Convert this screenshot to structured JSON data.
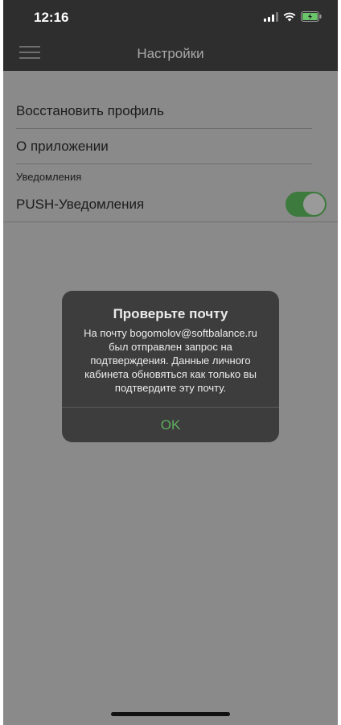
{
  "status_bar": {
    "time": "12:16"
  },
  "nav": {
    "title": "Настройки"
  },
  "settings": {
    "restore_profile": "Восстановить профиль",
    "about": "О приложении",
    "notifications_header": "Уведомления",
    "push_label": "PUSH-Уведомления",
    "push_enabled": true
  },
  "dialog": {
    "title": "Проверьте почту",
    "line1": "На почту bogomolov@softbalance.ru",
    "line2": "был отправлен запрос на",
    "line3": "подтверждения. Данные личного",
    "line4": "кабинета обновяться как только вы",
    "line5": "подтвердите эту почту.",
    "ok": "OK"
  },
  "colors": {
    "accent": "#5fae5f",
    "toggle_on": "#3d7a3d",
    "overlay": "#8a8a8a",
    "bar": "#2e2e2e"
  },
  "icons": {
    "status": [
      "signal-icon",
      "wifi-icon",
      "battery-charging-icon"
    ],
    "nav": [
      "hamburger-menu-icon"
    ]
  }
}
